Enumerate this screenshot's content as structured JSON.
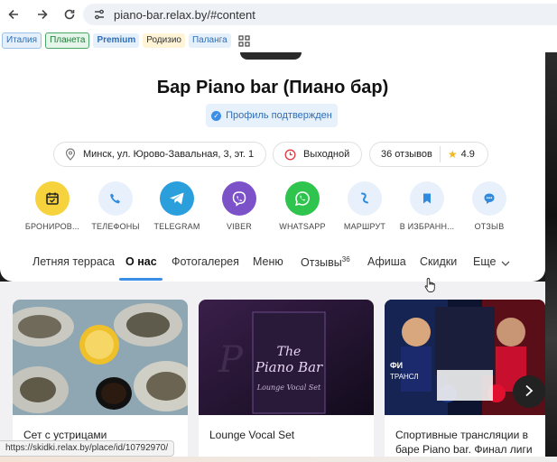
{
  "browser": {
    "url": "piano-bar.relax.by/#content",
    "bookmarks": [
      {
        "label": "Италия",
        "color": "#2f6eb5",
        "bg": "#e5f0fb",
        "border": "#9cc1e8"
      },
      {
        "label": "Планета",
        "color": "#1f7a3a",
        "bg": "#e6f5e9",
        "border": "#4aa866"
      },
      {
        "label": "Premium",
        "color": "#2f6eb5",
        "bg": "#e5f0fb",
        "border": "#e5f0fb"
      },
      {
        "label": "Родизио",
        "color": "#333333",
        "bg": "#fff4d6",
        "border": "#fff4d6"
      },
      {
        "label": "Паланга",
        "color": "#2f6eb5",
        "bg": "#e5f0fb",
        "border": "#e5f0fb"
      }
    ]
  },
  "place": {
    "title": "Бар Piano bar (Пиано бар)",
    "verified_label": "Профиль подтвержден",
    "address": "Минск, ул. Юрово-Завальная, 3, эт. 1",
    "hours": "Выходной",
    "reviews": "36 отзывов",
    "rating": "4.9"
  },
  "actions": [
    {
      "label": "БРОНИРОВ...",
      "icon": "calendar-icon",
      "bg": "#f6d33c",
      "fg": "#222222"
    },
    {
      "label": "ТЕЛЕФОНЫ",
      "icon": "phone-icon",
      "bg": "#e8f1fb",
      "fg": "#2f8ae0"
    },
    {
      "label": "TELEGRAM",
      "icon": "telegram-icon",
      "bg": "#2a9fdc",
      "fg": "#ffffff"
    },
    {
      "label": "VIBER",
      "icon": "viber-icon",
      "bg": "#7b52c8",
      "fg": "#ffffff"
    },
    {
      "label": "WHATSAPP",
      "icon": "whatsapp-icon",
      "bg": "#2ec44e",
      "fg": "#ffffff"
    },
    {
      "label": "МАРШРУТ",
      "icon": "route-icon",
      "bg": "#e8f1fb",
      "fg": "#2f8ae0"
    },
    {
      "label": "В ИЗБРАНН...",
      "icon": "bookmark-icon",
      "bg": "#e8f1fb",
      "fg": "#2f8ae0"
    },
    {
      "label": "ОТЗЫВ",
      "icon": "chat-icon",
      "bg": "#e8f1fb",
      "fg": "#2f8ae0"
    }
  ],
  "tabs": [
    {
      "label": "Летняя терраса"
    },
    {
      "label": "О нас",
      "active": true
    },
    {
      "label": "Фотогалерея"
    },
    {
      "label": "Меню"
    },
    {
      "label": "Отзывы",
      "count": "36"
    },
    {
      "label": "Афиша"
    },
    {
      "label": "Скидки"
    },
    {
      "label": "Еще"
    }
  ],
  "tiles": [
    {
      "caption": "Сет с устрицами"
    },
    {
      "caption": "Lounge Vocal Set"
    },
    {
      "caption": "Спортивные трансляции в баре Piano bar. Финал лиги"
    }
  ],
  "status_url": "https://skidki.relax.by/place/id/10792970/"
}
